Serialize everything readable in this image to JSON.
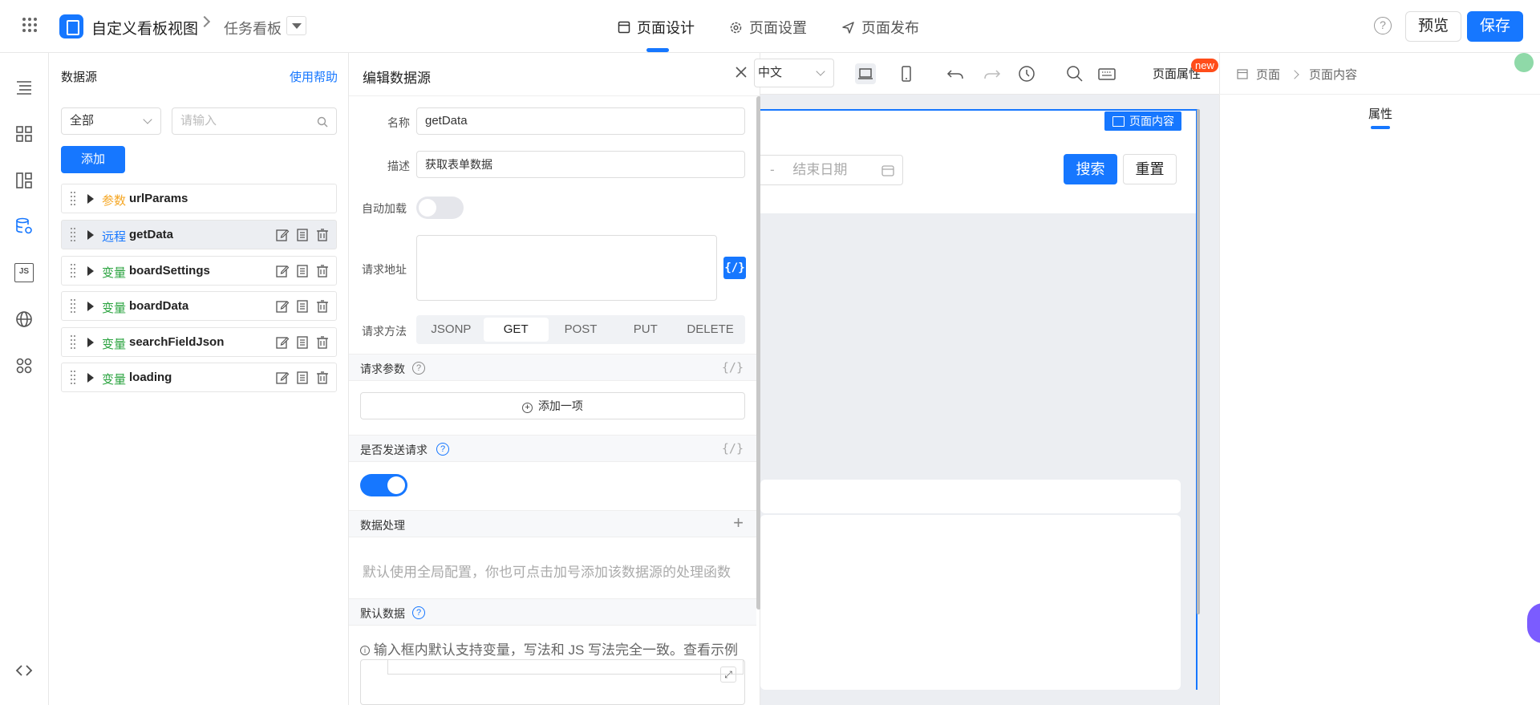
{
  "topbar": {
    "app_title": "自定义看板视图",
    "breadcrumb_current": "任务看板",
    "nav": [
      {
        "label": "页面设计",
        "icon": "layout-icon",
        "active": true
      },
      {
        "label": "页面设置",
        "icon": "gear-icon",
        "active": false
      },
      {
        "label": "页面发布",
        "icon": "send-icon",
        "active": false
      }
    ],
    "help_symbol": "?",
    "preview_label": "预览",
    "save_label": "保存",
    "accent": "#1677ff"
  },
  "rail": {
    "icons": [
      "outline-icon",
      "components-icon",
      "layout-icon",
      "datasource-icon",
      "js-icon",
      "globe-icon",
      "apps-icon",
      "code-icon"
    ],
    "active": "datasource-icon",
    "js_text": "JS"
  },
  "datasource": {
    "title": "数据源",
    "help_link": "使用帮助",
    "filter_value": "全部",
    "search_placeholder": "请输入",
    "add_label": "添加",
    "items": [
      {
        "type": "参数",
        "type_color": "#f5a623",
        "name": "urlParams",
        "selected": false,
        "actions": false
      },
      {
        "type": "远程",
        "type_color": "#1677ff",
        "name": "getData",
        "selected": true,
        "actions": true
      },
      {
        "type": "变量",
        "type_color": "#2aa33f",
        "name": "boardSettings",
        "selected": false,
        "actions": true
      },
      {
        "type": "变量",
        "type_color": "#2aa33f",
        "name": "boardData",
        "selected": false,
        "actions": true
      },
      {
        "type": "变量",
        "type_color": "#2aa33f",
        "name": "searchFieldJson",
        "selected": false,
        "actions": true
      },
      {
        "type": "变量",
        "type_color": "#2aa33f",
        "name": "loading",
        "selected": false,
        "actions": true
      }
    ]
  },
  "editor": {
    "title": "编辑数据源",
    "name_label": "名称",
    "name_value": "getData",
    "desc_label": "描述",
    "desc_value": "获取表单数据",
    "autoload_label": "自动加载",
    "autoload_on": false,
    "url_label": "请求地址",
    "fx_symbol": "{/}",
    "method_label": "请求方法",
    "methods": [
      "JSONP",
      "GET",
      "POST",
      "PUT",
      "DELETE"
    ],
    "method_selected": "GET",
    "params_label": "请求参数",
    "add_item_label": "添加一项",
    "send_label": "是否发送请求",
    "send_on": true,
    "processing_label": "数据处理",
    "processing_hint": "默认使用全局配置，你也可点击加号添加该数据源的处理函数",
    "default_data_label": "默认数据",
    "default_data_hint": "输入框内默认支持变量，写法和 JS 写法完全一致。查看示例"
  },
  "canvas": {
    "language": "中文",
    "page_props_label": "页面属性",
    "new_badge": "new",
    "frame_label": "页面内容",
    "date_separator": "-",
    "end_date_placeholder": "结束日期",
    "search_label": "搜索",
    "reset_label": "重置"
  },
  "props": {
    "breadcrumb_page": "页面",
    "breadcrumb_content": "页面内容",
    "tab_label": "属性"
  }
}
